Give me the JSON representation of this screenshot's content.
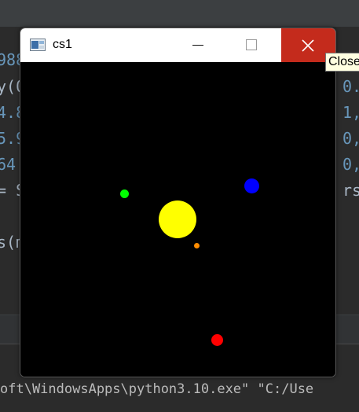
{
  "ide": {
    "code_left": [
      "988",
      "y(0",
      "4.8",
      "5.9",
      "64",
      "= S",
      "",
      "s(m"
    ],
    "code_right": [
      "0.",
      "0.",
      "1,",
      "0,",
      "0,",
      "rs]"
    ],
    "console_line": "oft\\WindowsApps\\python3.10.exe\" \"C:/Use"
  },
  "window": {
    "title": "cs1",
    "icon": "tk-feather-icon",
    "canvas_background": "#000000"
  },
  "bodies": [
    {
      "name": "sun",
      "color": "#ffff00"
    },
    {
      "name": "planet-green",
      "color": "#00ff00"
    },
    {
      "name": "planet-blue",
      "color": "#0000ff"
    },
    {
      "name": "planet-orange",
      "color": "#ff8c00"
    },
    {
      "name": "planet-red",
      "color": "#ff0000"
    }
  ],
  "tooltip": {
    "text": "Close"
  },
  "colors": {
    "close_button": "#c42b1c",
    "titlebar": "#ffffff"
  }
}
